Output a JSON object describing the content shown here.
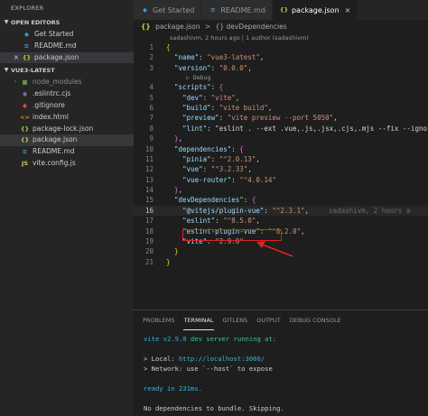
{
  "sidebar": {
    "explorer_title": "EXPLORER",
    "open_editors_title": "OPEN EDITORS",
    "open_editors": [
      {
        "label": "Get Started",
        "icon": "vscode-icon"
      },
      {
        "label": "README.md",
        "icon": "markdown-icon"
      },
      {
        "label": "package.json",
        "icon": "json-icon",
        "close": "×"
      }
    ],
    "project_title": "VUE3-LATEST",
    "files": [
      {
        "label": "node_modules",
        "icon": "folder-icon"
      },
      {
        "label": ".eslintrc.cjs",
        "icon": "eslint-icon"
      },
      {
        "label": ".gitignore",
        "icon": "git-icon"
      },
      {
        "label": "index.html",
        "icon": "html-icon"
      },
      {
        "label": "package-lock.json",
        "icon": "json-icon"
      },
      {
        "label": "package.json",
        "icon": "json-icon"
      },
      {
        "label": "README.md",
        "icon": "markdown-icon"
      },
      {
        "label": "vite.config.js",
        "icon": "js-icon"
      }
    ]
  },
  "tabs": [
    {
      "label": "Get Started"
    },
    {
      "label": "README.md"
    },
    {
      "label": "package.json",
      "close": "×"
    }
  ],
  "breadcrumb": {
    "file": "package.json",
    "sep": ">",
    "symbol": "{} devDependencies"
  },
  "codelens": "sadashivm, 2 hours ago | 1 author (sadashivm)",
  "debug_lens": "▷ Debug",
  "code_lines": [
    {
      "n": "1",
      "t": "{"
    },
    {
      "n": "2",
      "t": "  \"name\": \"vue3-latest\","
    },
    {
      "n": "3",
      "t": "  \"version\": \"0.0.0\","
    },
    {
      "n": "4",
      "t": "  \"scripts\": {"
    },
    {
      "n": "5",
      "t": "    \"dev\": \"vite\","
    },
    {
      "n": "6",
      "t": "    \"build\": \"vite build\","
    },
    {
      "n": "7",
      "t": "    \"preview\": \"vite preview --port 5050\","
    },
    {
      "n": "8",
      "t": "    \"lint\": \"eslint . --ext .vue,.js,.jsx,.cjs,.mjs --fix --igno"
    },
    {
      "n": "9",
      "t": "  },"
    },
    {
      "n": "10",
      "t": "  \"dependencies\": {"
    },
    {
      "n": "11",
      "t": "    \"pinia\": \"^2.0.13\","
    },
    {
      "n": "12",
      "t": "    \"vue\": \"^3.2.33\","
    },
    {
      "n": "13",
      "t": "    \"vue-router\": \"^4.0.14\""
    },
    {
      "n": "14",
      "t": "  },"
    },
    {
      "n": "15",
      "t": "  \"devDependencies\": {"
    },
    {
      "n": "16",
      "t": "    \"@vitejs/plugin-vue\": \"^2.3.1\","
    },
    {
      "n": "17",
      "t": "    \"eslint\": \"^8.5.0\","
    },
    {
      "n": "18",
      "t": "    \"eslint-plugin-vue\": \"^8.2.0\","
    },
    {
      "n": "19",
      "t": "    \"vite\": \"2.9.0\""
    },
    {
      "n": "20",
      "t": "  }"
    },
    {
      "n": "21",
      "t": "}"
    }
  ],
  "blame": "sadashivm, 2 hours a",
  "panel": {
    "tabs": [
      "PROBLEMS",
      "TERMINAL",
      "GITLENS",
      "OUTPUT",
      "DEBUG CONSOLE"
    ],
    "active_tab": "TERMINAL"
  },
  "terminal": {
    "l1_name": "vite v2.9.0",
    "l1_rest": " dev server running at:",
    "l2_prefix": "> Local: ",
    "l2_url": "http://localhost:3000/",
    "l3": "> Network: use `--host` to expose",
    "l4": "ready in 231ms.",
    "l5": "No dependencies to bundle. Skipping."
  },
  "colors": {
    "annotation_red": "#e02020",
    "key_blue": "#9cdcfe",
    "string_orange": "#ce9178"
  }
}
